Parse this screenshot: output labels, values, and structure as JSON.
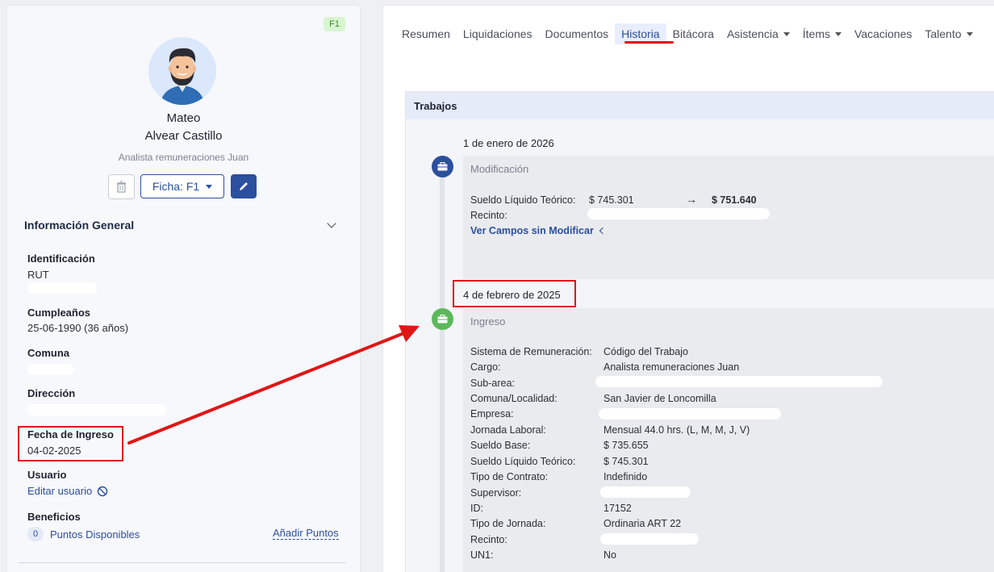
{
  "profile": {
    "badge": "F1",
    "first_name": "Mateo",
    "last_name": "Alvear Castillo",
    "job_title": "Analista remuneraciones Juan",
    "ficha_label": "Ficha: F1",
    "section_title": "Información General",
    "fields": {
      "identificacion_label": "Identificación",
      "identificacion_value": "RUT",
      "cumpleanos_label": "Cumpleaños",
      "cumpleanos_value": "25-06-1990 (36 años)",
      "comuna_label": "Comuna",
      "direccion_label": "Dirección",
      "fecha_ingreso_label": "Fecha de Ingreso",
      "fecha_ingreso_value": "04-02-2025",
      "usuario_label": "Usuario",
      "editar_usuario": "Editar usuario",
      "beneficios_label": "Beneficios",
      "puntos_count": "0",
      "puntos_label": "Puntos Disponibles",
      "anadir_puntos": "Añadir Puntos"
    }
  },
  "tabs": [
    {
      "label": "Resumen",
      "dropdown": false
    },
    {
      "label": "Liquidaciones",
      "dropdown": false
    },
    {
      "label": "Documentos",
      "dropdown": false
    },
    {
      "label": "Historia",
      "dropdown": false,
      "active": true
    },
    {
      "label": "Bitácora",
      "dropdown": false
    },
    {
      "label": "Asistencia",
      "dropdown": true
    },
    {
      "label": "Ítems",
      "dropdown": true
    },
    {
      "label": "Vacaciones",
      "dropdown": false
    },
    {
      "label": "Talento",
      "dropdown": true
    }
  ],
  "history": {
    "card_title": "Trabajos",
    "event1": {
      "date": "1 de enero de 2026",
      "title": "Modificación",
      "sueldo_label": "Sueldo Líquido Teórico:",
      "sueldo_old": "$ 745.301",
      "arrow": "→",
      "sueldo_new": "$ 751.640",
      "recinto_label": "Recinto:",
      "ver_campos": "Ver Campos sin Modificar"
    },
    "event2": {
      "date": "4 de febrero de 2025",
      "title": "Ingreso",
      "rows": [
        {
          "label": "Sistema de Remuneración:",
          "value": "Código del Trabajo"
        },
        {
          "label": "Cargo:",
          "value": "Analista remuneraciones Juan"
        },
        {
          "label": "Sub-area:",
          "value": ""
        },
        {
          "label": "Comuna/Localidad:",
          "value": "San Javier de Loncomilla"
        },
        {
          "label": "Empresa:",
          "value": ""
        },
        {
          "label": "Jornada Laboral:",
          "value": "Mensual 44.0 hrs. (L, M, M, J, V)"
        },
        {
          "label": "Sueldo Base:",
          "value": "$ 735.655"
        },
        {
          "label": "Sueldo Líquido Teórico:",
          "value": "$ 745.301"
        },
        {
          "label": "Tipo de Contrato:",
          "value": "Indefinido"
        },
        {
          "label": "Supervisor:",
          "value": ""
        },
        {
          "label": "ID:",
          "value": "17152"
        },
        {
          "label": "Tipo de Jornada:",
          "value": "Ordinaria ART 22"
        },
        {
          "label": "Recinto:",
          "value": ""
        },
        {
          "label": "UN1:",
          "value": "No"
        }
      ]
    }
  },
  "colors": {
    "primary": "#2c4f9e",
    "timeline_blue": "#2c4f9e",
    "timeline_green": "#5cb85c",
    "annotation_red": "#e01616"
  }
}
